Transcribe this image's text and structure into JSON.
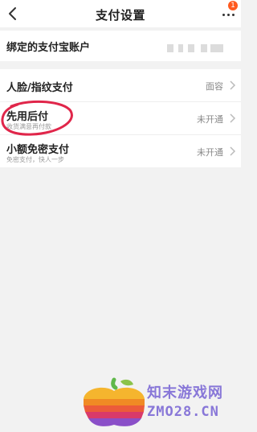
{
  "nav": {
    "title": "支付设置",
    "badge": "1"
  },
  "account_row": {
    "label": "绑定的支付宝账户"
  },
  "face_row": {
    "label": "人脸/指纹支付",
    "value": "面容"
  },
  "pay_later_row": {
    "label": "先用后付",
    "sub": "收货满意再付款",
    "value": "未开通"
  },
  "small_free_row": {
    "label": "小额免密支付",
    "sub": "免密支付，快人一步",
    "value": "未开通"
  },
  "watermark": {
    "cn": "知末游戏网",
    "en": "ZMO28.CN"
  },
  "colors": {
    "badge": "#ff5a1f",
    "annotation": "#e0264a",
    "watermark_text": "#8877d8"
  }
}
